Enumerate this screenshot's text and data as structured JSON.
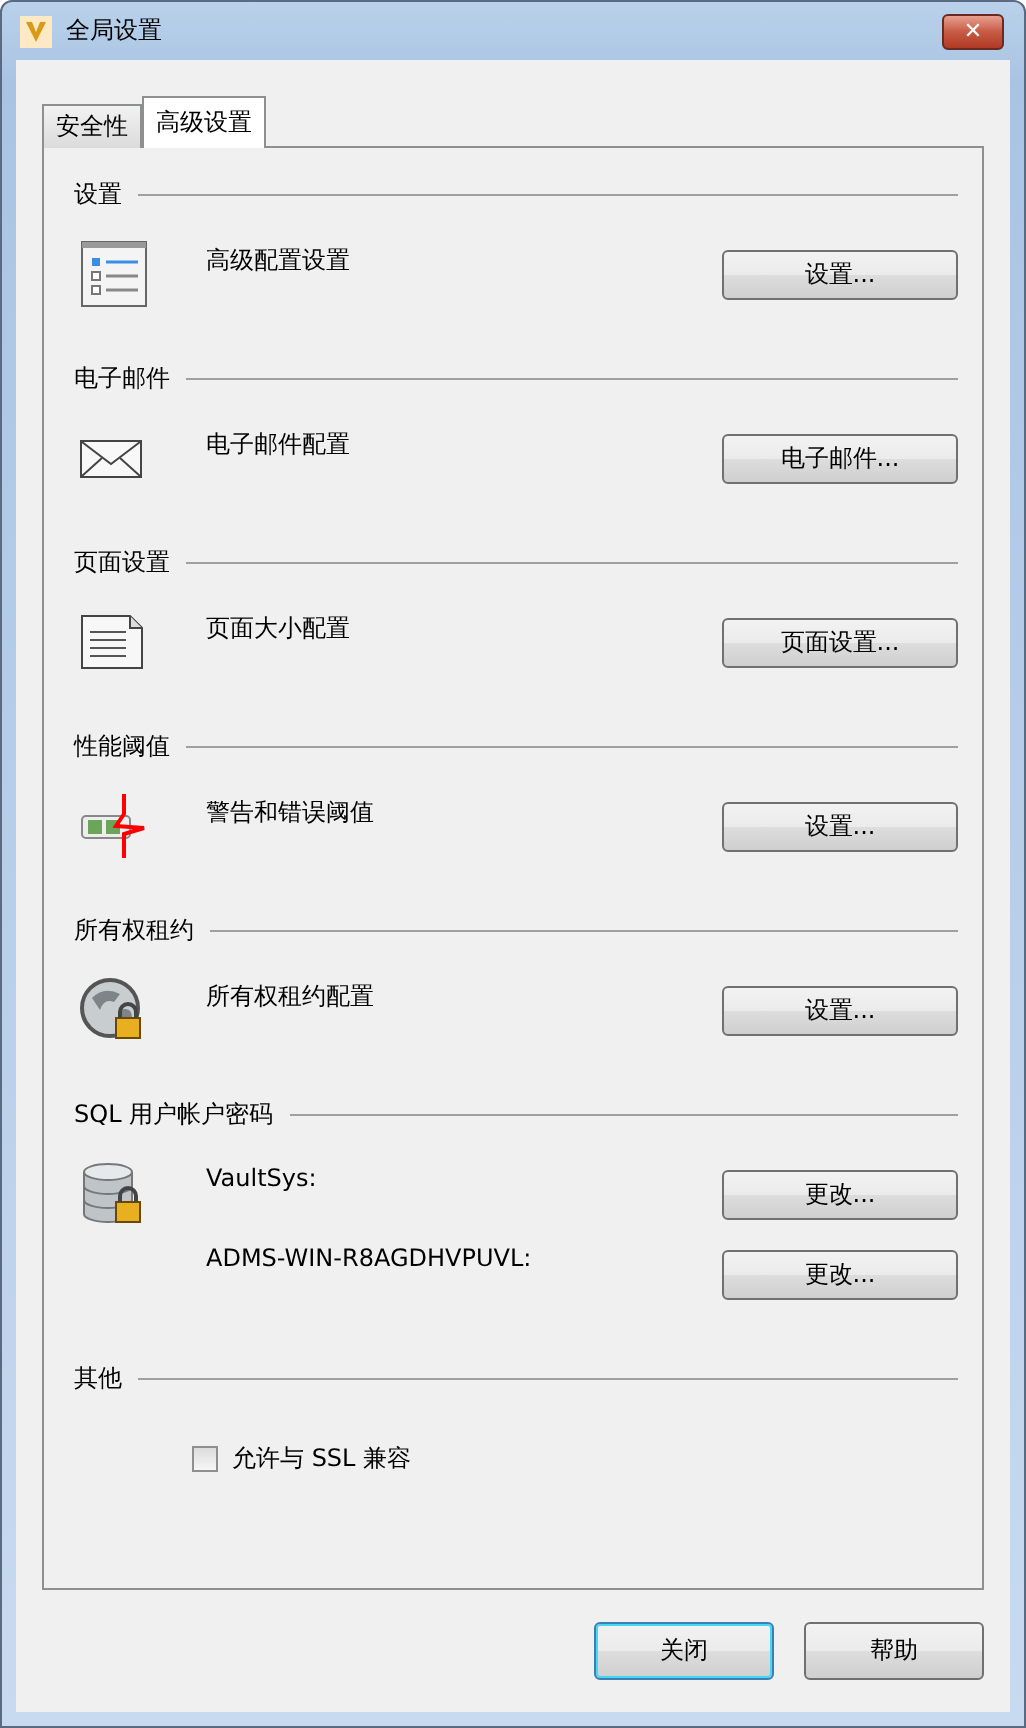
{
  "window": {
    "title": "全局设置",
    "close_glyph": "✕"
  },
  "tabs": [
    {
      "label": "安全性",
      "selected": false
    },
    {
      "label": "高级设置",
      "selected": true
    }
  ],
  "sections": [
    {
      "title": "设置",
      "icon": {
        "kind": "settings-list"
      },
      "rows": [
        {
          "kind": "button",
          "label": "高级配置设置",
          "button": "设置..."
        }
      ]
    },
    {
      "title": "电子邮件",
      "icon": {
        "kind": "envelope"
      },
      "rows": [
        {
          "kind": "button",
          "label": "电子邮件配置",
          "button": "电子邮件..."
        }
      ]
    },
    {
      "title": "页面设置",
      "icon": {
        "kind": "document"
      },
      "rows": [
        {
          "kind": "button",
          "label": "页面大小配置",
          "button": "页面设置..."
        }
      ]
    },
    {
      "title": "性能阈值",
      "icon": {
        "kind": "meter"
      },
      "rows": [
        {
          "kind": "button",
          "label": "警告和错误阈值",
          "button": "设置..."
        }
      ]
    },
    {
      "title": "所有权租约",
      "icon": {
        "kind": "globe-lock"
      },
      "rows": [
        {
          "kind": "button",
          "label": "所有权租约配置",
          "button": "设置..."
        }
      ]
    },
    {
      "title": "SQL 用户帐户密码",
      "icon": {
        "kind": "database-lock"
      },
      "rows": [
        {
          "kind": "button",
          "label": "VaultSys:",
          "button": "更改..."
        },
        {
          "kind": "button",
          "label": "ADMS-WIN-R8AGDHVPUVL:",
          "button": "更改..."
        }
      ]
    },
    {
      "title": "其他",
      "rows": [
        {
          "kind": "checkbox",
          "label": "允许与 SSL 兼容",
          "checked": false
        }
      ]
    }
  ],
  "footer": {
    "buttons": [
      {
        "label": "关闭",
        "default": true
      },
      {
        "label": "帮助",
        "default": false
      }
    ]
  }
}
